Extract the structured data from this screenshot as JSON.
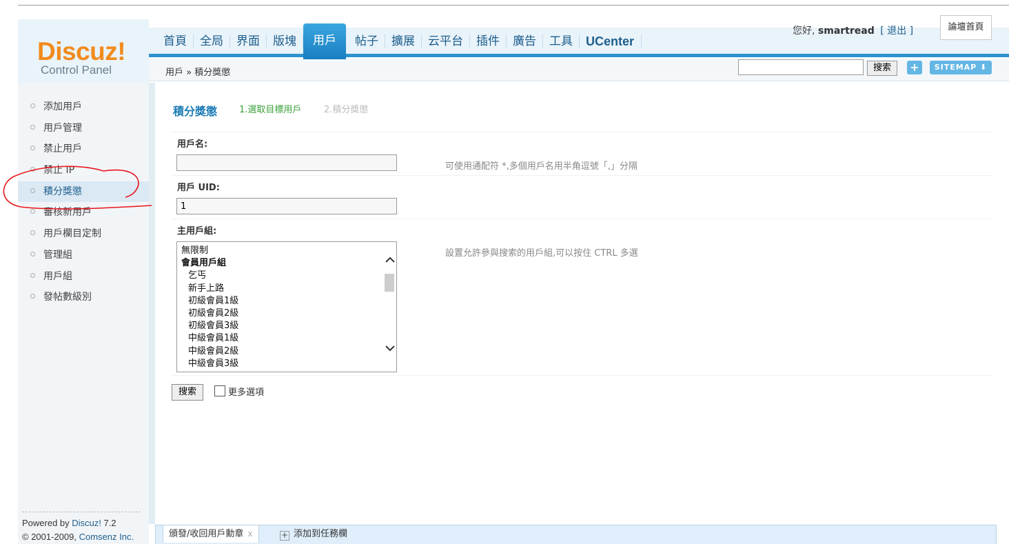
{
  "header": {
    "logo": "Discuz!",
    "logo_sub": "Control Panel",
    "nav": [
      "首頁",
      "全局",
      "界面",
      "版塊",
      "用戶",
      "帖子",
      "擴展",
      "云平台",
      "插件",
      "廣告",
      "工具",
      "UCenter"
    ],
    "active_nav": "用戶",
    "greeting_prefix": "您好,",
    "username": "smartread",
    "logout": "[ 退出 ]",
    "forum_home": "論壇首頁"
  },
  "subbar": {
    "breadcrumb": "用戶 » 積分獎懲",
    "search_value": "",
    "search_button": "搜索",
    "plus": "+",
    "sitemap": "SITEMAP ⬇"
  },
  "sidebar": {
    "items": [
      "添加用戶",
      "用戶管理",
      "禁止用戶",
      "禁止 IP",
      "積分獎懲",
      "審核新用戶",
      "用戶欄目定制",
      "管理組",
      "用戶組",
      "發帖數級別"
    ],
    "active_item": "積分獎懲",
    "powered_prefix": "Powered by ",
    "powered_brand": "Discuz!",
    "powered_version": " 7.2",
    "copyright_prefix": "© 2001-2009, ",
    "copyright_company": "Comsenz Inc."
  },
  "main": {
    "title": "積分獎懲",
    "step1": "1.選取目標用戶",
    "step2": "2.積分獎懲",
    "username_label": "用戶名:",
    "username_value": "",
    "username_hint": "可使用通配符 *,多個用戶名用半角逗號「,」分隔",
    "uid_label": "用戶 UID:",
    "uid_value": "1",
    "group_label": "主用戶組:",
    "group_hint": "設置允許參與搜索的用戶組,可以按住 CTRL 多選",
    "group_options": [
      {
        "text": "無限制",
        "kind": "plain"
      },
      {
        "text": "會員用戶組",
        "kind": "group"
      },
      {
        "text": "乞丐",
        "kind": "child"
      },
      {
        "text": "新手上路",
        "kind": "child"
      },
      {
        "text": "初級會員1級",
        "kind": "child"
      },
      {
        "text": "初級會員2級",
        "kind": "child"
      },
      {
        "text": "初級會員3級",
        "kind": "child"
      },
      {
        "text": "中級會員1級",
        "kind": "child"
      },
      {
        "text": "中級會員2級",
        "kind": "child"
      },
      {
        "text": "中級會員3級",
        "kind": "child"
      }
    ],
    "search_button": "搜索",
    "more_options": "更多選項"
  },
  "taskbar": {
    "item": "頒發/收回用戶勳章",
    "close": "x",
    "add": "添加到任務欄"
  },
  "colors": {
    "accent": "#2d93cf",
    "logo": "#f18b1e",
    "annotation": "#e8141c"
  }
}
